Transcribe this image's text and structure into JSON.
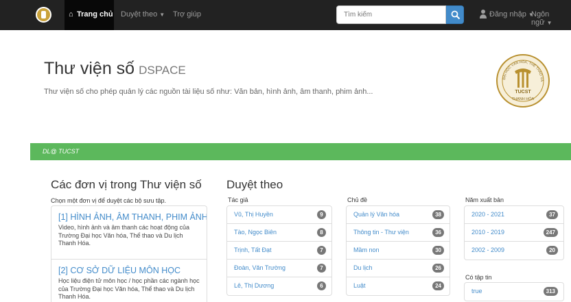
{
  "navbar": {
    "home_label": "Trang chủ",
    "browse_label": "Duyệt theo",
    "help_label": "Trợ giúp",
    "search_placeholder": "Tìm kiếm",
    "login_label": "Đăng nhập",
    "language_label": "Ngôn ngữ"
  },
  "header": {
    "title": "Thư viện số",
    "title_small": "DSPACE",
    "description": "Thư viện số cho phép quản lý các nguồn tài liệu số như: Văn bản, hình ảnh, âm thanh, phim ảnh..."
  },
  "trail": {
    "label": "DL@ TUCST"
  },
  "communities": {
    "title": "Các đơn vị trong Thư viện số",
    "subtitle": "Chọn một đơn vị để duyệt các bộ sưu tập.",
    "items": [
      {
        "name": "[1] HÌNH ẢNH, ÂM THANH, PHIM ẢNH",
        "description": "Video, hình ảnh và âm thanh các hoạt động của Trường Đại học Văn hóa, Thể thao và Du lịch Thanh Hóa."
      },
      {
        "name": "[2] CƠ SỞ DỮ LIỆU MÔN HỌC",
        "description": "Học liệu điện tử môn học / học phần các ngành học của Trường Đại học Văn hóa, Thể thao và Du lịch Thanh Hóa."
      }
    ]
  },
  "browse": {
    "title": "Duyệt theo",
    "authors": {
      "label": "Tác giả",
      "items": [
        {
          "name": "Vũ, Thị Huyền",
          "count": "9"
        },
        {
          "name": "Tào, Ngọc Biên",
          "count": "8"
        },
        {
          "name": "Trịnh, Tất Đạt",
          "count": "7"
        },
        {
          "name": "Đoàn, Văn Trường",
          "count": "7"
        },
        {
          "name": "Lê, Thị Dương",
          "count": "6"
        }
      ]
    },
    "subjects": {
      "label": "Chủ đề",
      "items": [
        {
          "name": "Quản lý Văn hóa",
          "count": "38"
        },
        {
          "name": "Thông tin - Thư viện",
          "count": "36"
        },
        {
          "name": "Mầm non",
          "count": "30"
        },
        {
          "name": "Du lịch",
          "count": "26"
        },
        {
          "name": "Luật",
          "count": "24"
        }
      ]
    },
    "years": {
      "label": "Năm xuất bản",
      "items": [
        {
          "name": "2020 - 2021",
          "count": "37"
        },
        {
          "name": "2010 - 2019",
          "count": "247"
        },
        {
          "name": "2002 - 2009",
          "count": "20"
        }
      ]
    },
    "has_file": {
      "label": "Có tập tin",
      "items": [
        {
          "name": "true",
          "count": "313"
        }
      ]
    }
  },
  "seal": {
    "text_top": "TRƯỜNG ĐẠI HỌC VĂN HÓA, THỂ THAO VÀ DU LỊCH",
    "text_mid": "TUCST",
    "text_bottom": "THANH HÓA"
  },
  "colors": {
    "navbar": "#222222",
    "accent": "#428bca",
    "trail": "#5cb85c",
    "badge": "#777777"
  }
}
